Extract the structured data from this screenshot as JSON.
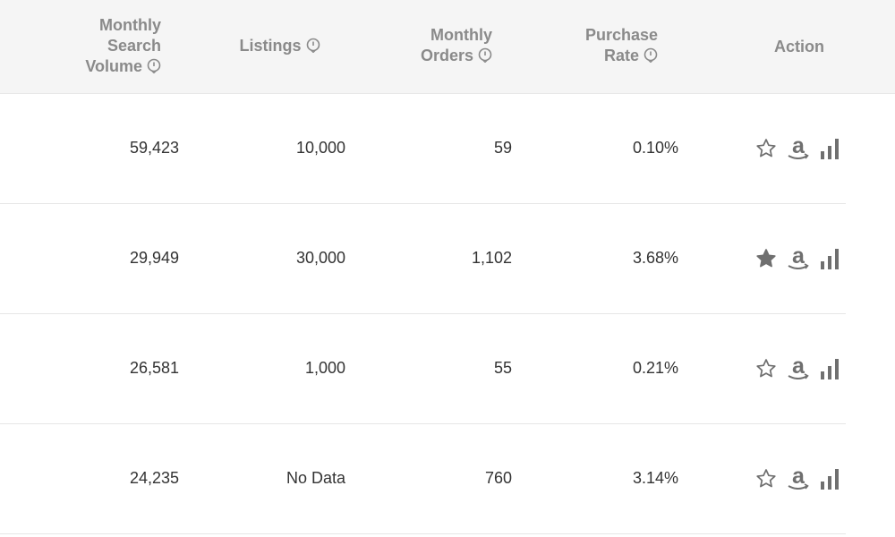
{
  "header": {
    "monthly_search_volume": [
      "Monthly",
      "Search",
      "Volume"
    ],
    "listings": "Listings",
    "monthly_orders": [
      "Monthly",
      "Orders"
    ],
    "purchase_rate": [
      "Purchase",
      "Rate"
    ],
    "action": "Action"
  },
  "rows": [
    {
      "search_volume": "59,423",
      "listings": "10,000",
      "orders": "59",
      "purchase_rate": "0.10%",
      "favorited": false
    },
    {
      "search_volume": "29,949",
      "listings": "30,000",
      "orders": "1,102",
      "purchase_rate": "3.68%",
      "favorited": true
    },
    {
      "search_volume": "26,581",
      "listings": "1,000",
      "orders": "55",
      "purchase_rate": "0.21%",
      "favorited": false
    },
    {
      "search_volume": "24,235",
      "listings": "No Data",
      "orders": "760",
      "purchase_rate": "3.14%",
      "favorited": false
    }
  ],
  "icons": {
    "info": "info-icon",
    "favorite": "star-icon",
    "amazon": "amazon-icon",
    "trend": "bar-chart-icon"
  },
  "colors": {
    "header_bg": "#f5f5f5",
    "header_text": "#8a8a8a",
    "icon_gray": "#6f6f6f",
    "row_divider": "#e6e6e6"
  }
}
